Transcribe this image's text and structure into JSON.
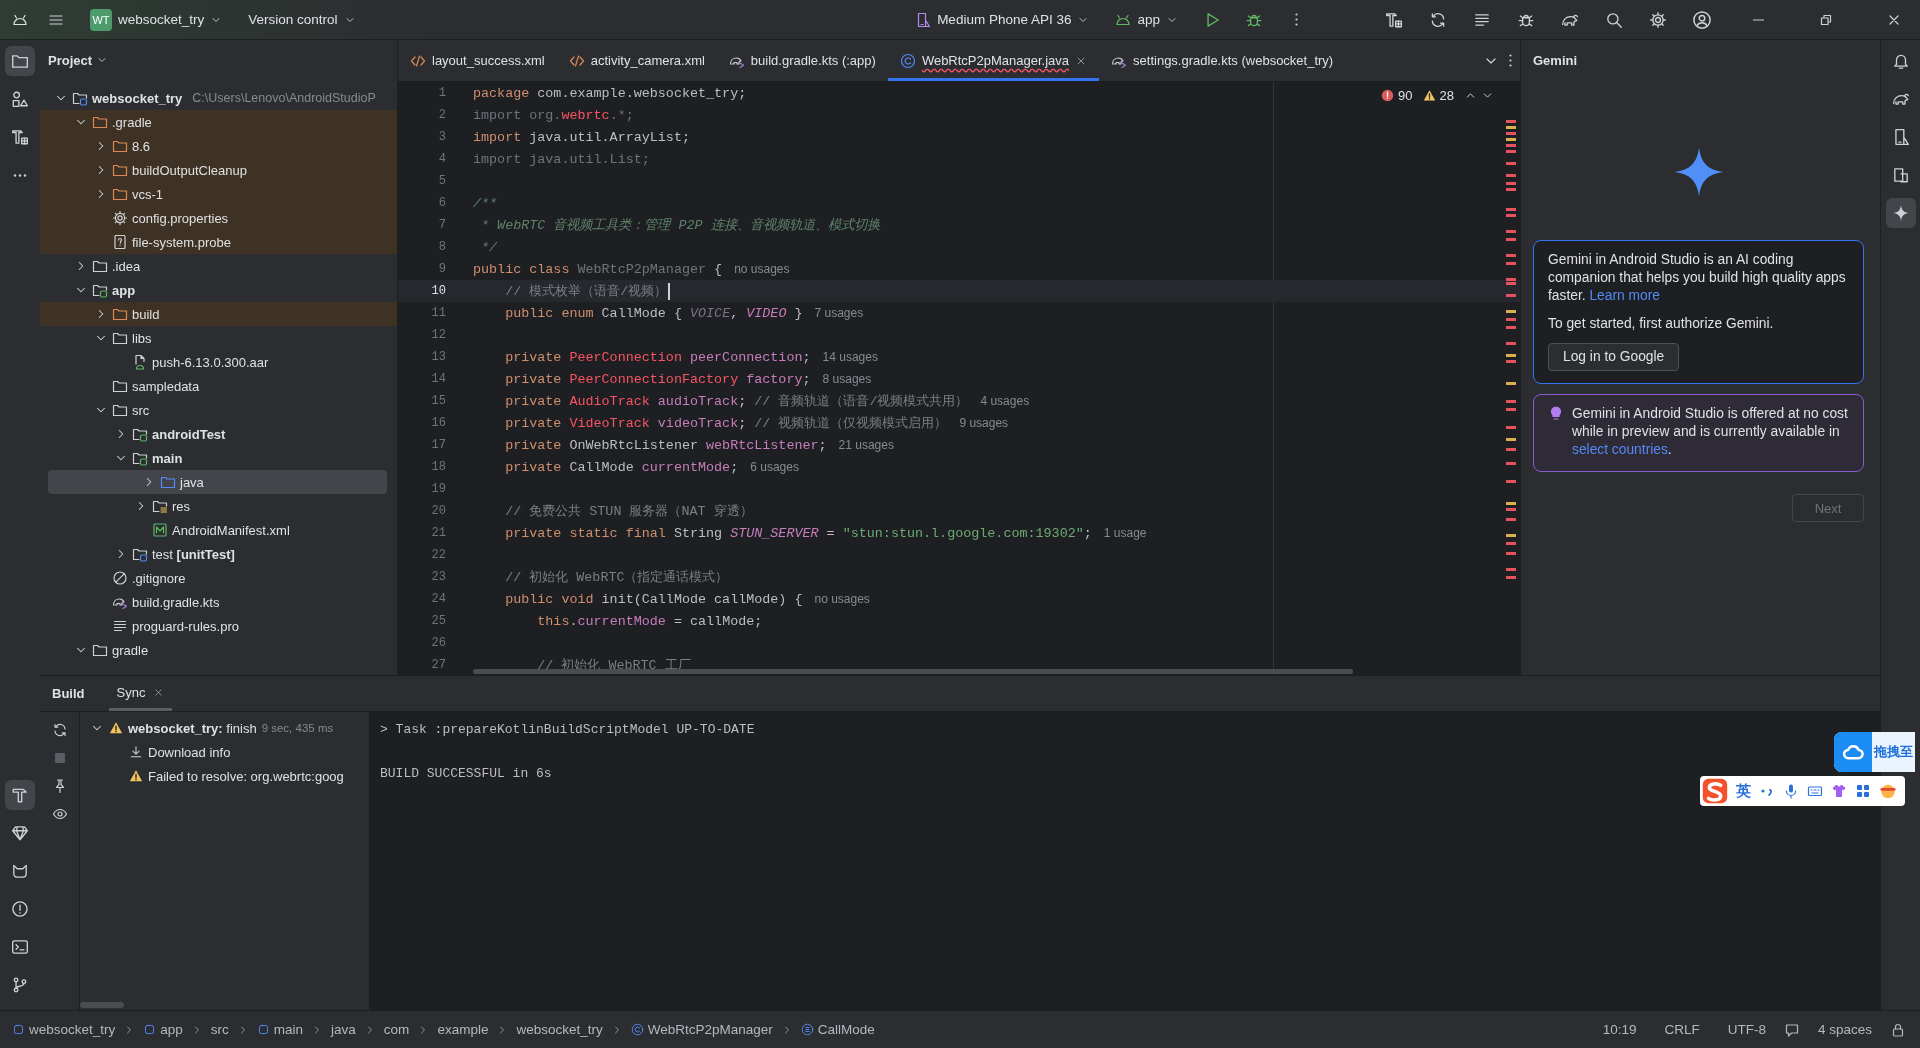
{
  "title_bar": {
    "project_badge": "WT",
    "project_name": "websocket_try",
    "vcs": "Version control",
    "device": "Medium Phone API 36",
    "run_config": "app"
  },
  "left_toolbar": {
    "top": [
      {
        "kind": "project",
        "selected": true
      },
      {
        "kind": "resources",
        "selected": false
      },
      {
        "kind": "structure",
        "selected": false
      },
      {
        "kind": "more",
        "selected": false
      }
    ],
    "bottom": [
      {
        "kind": "build",
        "selected": true
      },
      {
        "kind": "quality",
        "selected": false
      },
      {
        "kind": "logcat",
        "selected": false
      },
      {
        "kind": "problems",
        "selected": false
      },
      {
        "kind": "terminal",
        "selected": false
      },
      {
        "kind": "vcs",
        "selected": false
      }
    ]
  },
  "right_toolbar": [
    {
      "kind": "notifications",
      "selected": false
    },
    {
      "kind": "gradle",
      "selected": false
    },
    {
      "kind": "device-manager",
      "selected": false
    },
    {
      "kind": "running-devices",
      "selected": false
    },
    {
      "kind": "gemini",
      "selected": true
    }
  ],
  "project": {
    "title": "Project",
    "tree": [
      {
        "label": "websocket_try",
        "path": "C:\\Users\\Lenovo\\AndroidStudioP",
        "kind": "project",
        "expanded": true,
        "selected": false,
        "children": [
          {
            "label": ".gradle",
            "kind": "excluded-folder",
            "expanded": true,
            "selected": false,
            "children": [
              {
                "label": "8.6",
                "kind": "excluded-folder",
                "expanded": false,
                "selected": false
              },
              {
                "label": "buildOutputCleanup",
                "kind": "excluded-folder",
                "expanded": false,
                "selected": false
              },
              {
                "label": "vcs-1",
                "kind": "excluded-folder",
                "expanded": false,
                "selected": false
              },
              {
                "label": "config.properties",
                "kind": "settings-file",
                "selected": false
              },
              {
                "label": "file-system.probe",
                "kind": "probe-file",
                "selected": false
              }
            ]
          },
          {
            "label": ".idea",
            "kind": "folder",
            "expanded": false,
            "selected": false
          },
          {
            "label": "app",
            "kind": "module",
            "expanded": true,
            "selected": false,
            "children": [
              {
                "label": "build",
                "kind": "excluded-folder",
                "expanded": false,
                "selected": false
              },
              {
                "label": "libs",
                "kind": "folder",
                "expanded": true,
                "selected": false,
                "children": [
                  {
                    "label": "push-6.13.0.300.aar",
                    "kind": "aar-file",
                    "selected": false
                  }
                ]
              },
              {
                "label": "sampledata",
                "kind": "folder",
                "selected": false
              },
              {
                "label": "src",
                "kind": "folder",
                "expanded": true,
                "selected": false,
                "children": [
                  {
                    "label": "androidTest",
                    "kind": "module",
                    "expanded": false,
                    "selected": false
                  },
                  {
                    "label": "main",
                    "kind": "module",
                    "expanded": true,
                    "selected": false,
                    "children": [
                      {
                        "label": "java",
                        "kind": "source-folder",
                        "expanded": false,
                        "selected": true
                      },
                      {
                        "label": "res",
                        "kind": "res-folder",
                        "expanded": false,
                        "selected": false
                      },
                      {
                        "label": "AndroidManifest.xml",
                        "kind": "manifest-file",
                        "selected": false
                      }
                    ]
                  },
                  {
                    "label": "test **[unitTest]**",
                    "kind": "test-module",
                    "expanded": false,
                    "selected": false
                  }
                ]
              },
              {
                "label": ".gitignore",
                "kind": "ignore-file",
                "selected": false
              },
              {
                "label": "build.gradle.kts",
                "kind": "gradle-file",
                "selected": false
              },
              {
                "label": "proguard-rules.pro",
                "kind": "text-file",
                "selected": false
              }
            ]
          },
          {
            "label": "gradle",
            "kind": "folder",
            "expanded": true,
            "selected": false
          }
        ]
      }
    ]
  },
  "editor": {
    "tabs": [
      {
        "label": "layout_success.xml",
        "kind": "xml",
        "selected": false,
        "has_errors": false
      },
      {
        "label": "activity_camera.xml",
        "kind": "xml",
        "selected": false,
        "has_errors": false
      },
      {
        "label": "build.gradle.kts (:app)",
        "kind": "gradle",
        "selected": false,
        "has_errors": false
      },
      {
        "label": "WebRtcP2pManager.java",
        "kind": "java",
        "selected": true,
        "has_errors": true
      },
      {
        "label": "settings.gradle.kts (websocket_try)",
        "kind": "gradle",
        "selected": false,
        "has_errors": false
      }
    ],
    "errors": "90",
    "warnings": "28",
    "lines": [
      {
        "number": "1",
        "current": false,
        "tokens": [
          {
            "kind": "keyword",
            "text": "package"
          },
          {
            "kind": "plain",
            "text": " com.example.websocket_try;"
          }
        ]
      },
      {
        "number": "2",
        "current": false,
        "tokens": [
          {
            "kind": "unused",
            "text": "import org."
          },
          {
            "kind": "error",
            "text": "webrtc"
          },
          {
            "kind": "unused",
            "text": ".*;"
          }
        ]
      },
      {
        "number": "3",
        "current": false,
        "tokens": [
          {
            "kind": "keyword",
            "text": "import"
          },
          {
            "kind": "plain",
            "text": " java.util.ArrayList;"
          }
        ]
      },
      {
        "number": "4",
        "current": false,
        "tokens": [
          {
            "kind": "unused",
            "text": "import java.util.List;"
          }
        ]
      },
      {
        "number": "5",
        "current": false
      },
      {
        "number": "6",
        "current": false,
        "tokens": [
          {
            "kind": "doc",
            "text": "/**"
          }
        ]
      },
      {
        "number": "7",
        "current": false,
        "tokens": [
          {
            "kind": "doc",
            "text": " * WebRTC 音视频工具类：管理 P2P 连接、音视频轨道、模式切换"
          }
        ]
      },
      {
        "number": "8",
        "current": false,
        "tokens": [
          {
            "kind": "doc",
            "text": " */"
          }
        ]
      },
      {
        "number": "9",
        "current": false,
        "tokens": [
          {
            "kind": "keyword",
            "text": "public class "
          },
          {
            "kind": "unused",
            "text": "WebRtcP2pManager"
          },
          {
            "kind": "plain",
            "text": " {"
          }
        ],
        "hint": "no usages"
      },
      {
        "number": "10",
        "current": true,
        "tokens": [
          {
            "kind": "comment",
            "text": "    // 模式枚举（语音/视频）"
          }
        ]
      },
      {
        "number": "11",
        "current": false,
        "tokens": [
          {
            "kind": "keyword",
            "text": "    public enum "
          },
          {
            "kind": "plain",
            "text": "CallMode { "
          },
          {
            "kind": "unused-constant",
            "text": "VOICE"
          },
          {
            "kind": "plain",
            "text": ", "
          },
          {
            "kind": "constant",
            "text": "VIDEO"
          },
          {
            "kind": "plain",
            "text": " }"
          }
        ],
        "hint": "7 usages"
      },
      {
        "number": "12",
        "current": false
      },
      {
        "number": "13",
        "current": false,
        "tokens": [
          {
            "kind": "keyword",
            "text": "    private "
          },
          {
            "kind": "error",
            "text": "PeerConnection"
          },
          {
            "kind": "field",
            "text": " peerConnection"
          },
          {
            "kind": "plain",
            "text": ";"
          }
        ],
        "hint": "14 usages"
      },
      {
        "number": "14",
        "current": false,
        "tokens": [
          {
            "kind": "keyword",
            "text": "    private "
          },
          {
            "kind": "error",
            "text": "PeerConnectionFactory"
          },
          {
            "kind": "field",
            "text": " factory"
          },
          {
            "kind": "plain",
            "text": ";"
          }
        ],
        "hint": "8 usages"
      },
      {
        "number": "15",
        "current": false,
        "tokens": [
          {
            "kind": "keyword",
            "text": "    private "
          },
          {
            "kind": "error",
            "text": "AudioTrack"
          },
          {
            "kind": "field",
            "text": " audioTrack"
          },
          {
            "kind": "plain",
            "text": "; "
          },
          {
            "kind": "comment",
            "text": "// 音频轨道（语音/视频模式共用）"
          }
        ],
        "hint": "4 usages"
      },
      {
        "number": "16",
        "current": false,
        "tokens": [
          {
            "kind": "keyword",
            "text": "    private "
          },
          {
            "kind": "error",
            "text": "VideoTrack"
          },
          {
            "kind": "field",
            "text": " videoTrack"
          },
          {
            "kind": "plain",
            "text": "; "
          },
          {
            "kind": "comment",
            "text": "// 视频轨道（仅视频模式启用）"
          }
        ],
        "hint": "9 usages"
      },
      {
        "number": "17",
        "current": false,
        "tokens": [
          {
            "kind": "keyword",
            "text": "    private "
          },
          {
            "kind": "plain",
            "text": "OnWebRtcListener "
          },
          {
            "kind": "field",
            "text": "webRtcListener"
          },
          {
            "kind": "plain",
            "text": ";"
          }
        ],
        "hint": "21 usages"
      },
      {
        "number": "18",
        "current": false,
        "tokens": [
          {
            "kind": "keyword",
            "text": "    private "
          },
          {
            "kind": "plain",
            "text": "CallMode "
          },
          {
            "kind": "field",
            "text": "currentMode"
          },
          {
            "kind": "plain",
            "text": ";"
          }
        ],
        "hint": "6 usages"
      },
      {
        "number": "19",
        "current": false
      },
      {
        "number": "20",
        "current": false,
        "tokens": [
          {
            "kind": "comment",
            "text": "    // 免费公共 STUN 服务器（NAT 穿透）"
          }
        ]
      },
      {
        "number": "21",
        "current": false,
        "tokens": [
          {
            "kind": "keyword",
            "text": "    private static final "
          },
          {
            "kind": "plain",
            "text": "String "
          },
          {
            "kind": "constant",
            "text": "STUN_SERVER"
          },
          {
            "kind": "plain",
            "text": " = "
          },
          {
            "kind": "string",
            "text": "\"stun:stun.l.google.com:19302\""
          },
          {
            "kind": "plain",
            "text": ";"
          }
        ],
        "hint": "1 usage"
      },
      {
        "number": "22",
        "current": false
      },
      {
        "number": "23",
        "current": false,
        "tokens": [
          {
            "kind": "comment",
            "text": "    // 初始化 WebRTC（指定通话模式）"
          }
        ]
      },
      {
        "number": "24",
        "current": false,
        "tokens": [
          {
            "kind": "keyword",
            "text": "    public void "
          },
          {
            "kind": "plain",
            "text": "init(CallMode callMode) {"
          }
        ],
        "hint": "no usages"
      },
      {
        "number": "25",
        "current": false,
        "tokens": [
          {
            "kind": "keyword",
            "text": "        this"
          },
          {
            "kind": "plain",
            "text": "."
          },
          {
            "kind": "field",
            "text": "currentMode"
          },
          {
            "kind": "plain",
            "text": " = callMode;"
          }
        ]
      },
      {
        "number": "26",
        "current": false
      },
      {
        "number": "27",
        "current": false,
        "tokens": [
          {
            "kind": "comment",
            "text": "        // 初始化 WebRTC 工厂"
          }
        ]
      }
    ]
  },
  "gemini": {
    "title": "Gemini",
    "intro": "Gemini in Android Studio is an AI coding companion that helps you build high quality apps faster.",
    "learn_more": "Learn more",
    "authorize": "To get started, first authorize Gemini.",
    "login_button": "Log in to Google",
    "notice": "Gemini in Android Studio is offered at no cost while in preview and is currently available in",
    "notice_link": "select countries",
    "notice_end": ".",
    "next_button": {
      "label": "Next",
      "disabled": true
    }
  },
  "build": {
    "title": "Build",
    "tabs": [
      {
        "label": "Sync",
        "selected": true
      }
    ],
    "tree": [
      {
        "label": "**websocket_try:** finish",
        "time": "9 sec, 435 ms",
        "kind": "warning",
        "expanded": true,
        "children": [
          {
            "label": "Download info",
            "kind": "download"
          },
          {
            "label": "Failed to resolve: org.webrtc:goog",
            "kind": "warning"
          }
        ]
      }
    ],
    "console": [
      "> Task :prepareKotlinBuildScriptModel UP-TO-DATE",
      "BUILD SUCCESSFUL in 6s"
    ]
  },
  "status_bar": {
    "breadcrumbs": [
      {
        "label": "websocket_try",
        "kind": "module"
      },
      {
        "label": "app",
        "kind": "module"
      },
      {
        "label": "src",
        "kind": "plain"
      },
      {
        "label": "main",
        "kind": "module"
      },
      {
        "label": "java",
        "kind": "plain"
      },
      {
        "label": "com",
        "kind": "plain"
      },
      {
        "label": "example",
        "kind": "plain"
      },
      {
        "label": "websocket_try",
        "kind": "plain"
      },
      {
        "label": "WebRtcP2pManager",
        "kind": "class"
      },
      {
        "label": "CallMode",
        "kind": "enum"
      }
    ],
    "position": "10:19",
    "line_separator": "CRLF",
    "encoding": "UTF-8",
    "indent": "4 spaces"
  },
  "overlays": {
    "drag_pill": "拖拽至",
    "ime_mode": "英"
  }
}
